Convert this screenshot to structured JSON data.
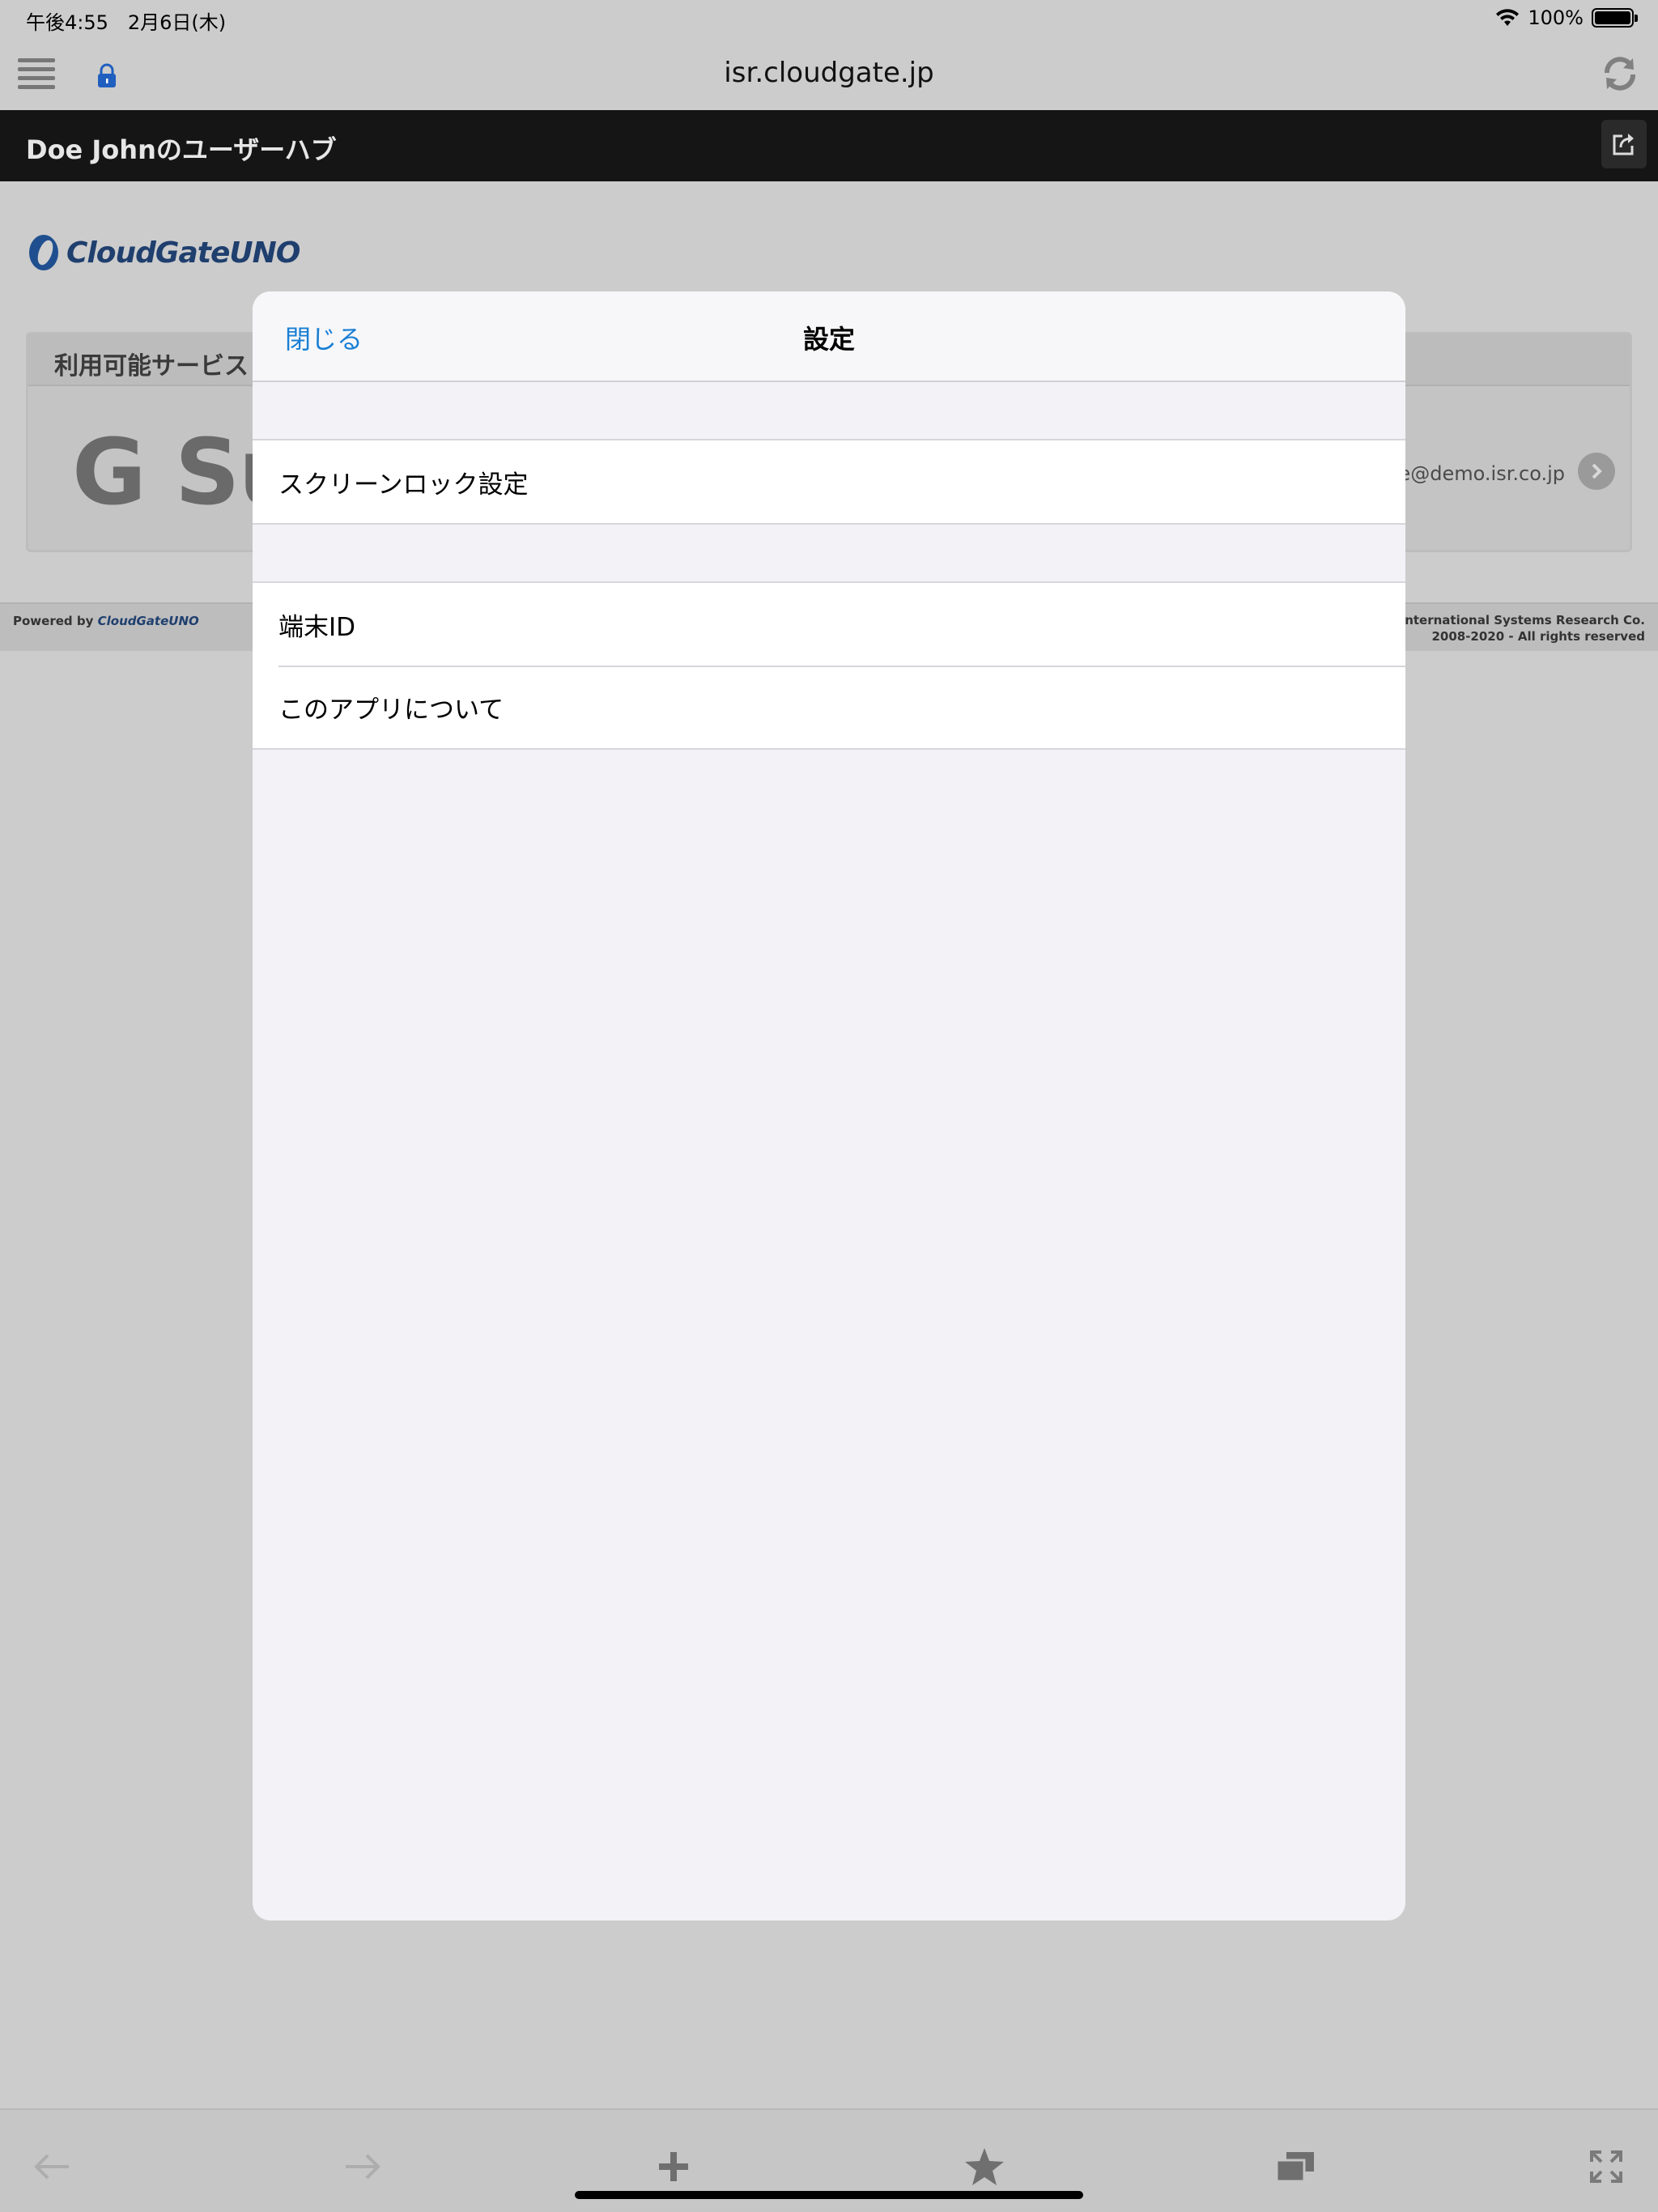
{
  "status_bar": {
    "time": "午後4:55　2月6日(木)",
    "battery": "100%"
  },
  "browser": {
    "url": "isr.cloudgate.jp"
  },
  "page_header": {
    "title": "Doe Johnのユーザーハブ"
  },
  "background_page": {
    "logo_text": "CloudGateUNO",
    "services_header": "利用可能サービス",
    "service_name": "G Su",
    "service_email": "oe@demo.isr.co.jp",
    "footer": {
      "powered_by": "Powered by",
      "powered_logo": "CloudGateUNO",
      "copyright_line1": "© International Systems Research Co.",
      "copyright_line2": "2008-2020 - All rights reserved"
    }
  },
  "modal": {
    "close_label": "閉じる",
    "title": "設定",
    "groups": [
      {
        "rows": [
          "スクリーンロック設定"
        ]
      },
      {
        "rows": [
          "端末ID",
          "このアプリについて"
        ]
      }
    ]
  },
  "toolbar": {
    "icons": [
      "back-arrow-icon",
      "forward-arrow-icon",
      "plus-icon",
      "star-icon",
      "tabs-icon",
      "fullscreen-icon"
    ]
  },
  "colors": {
    "accent": "#1a7fd4",
    "header_bg": "#151515",
    "page_dim_bg": "#cccccc"
  }
}
